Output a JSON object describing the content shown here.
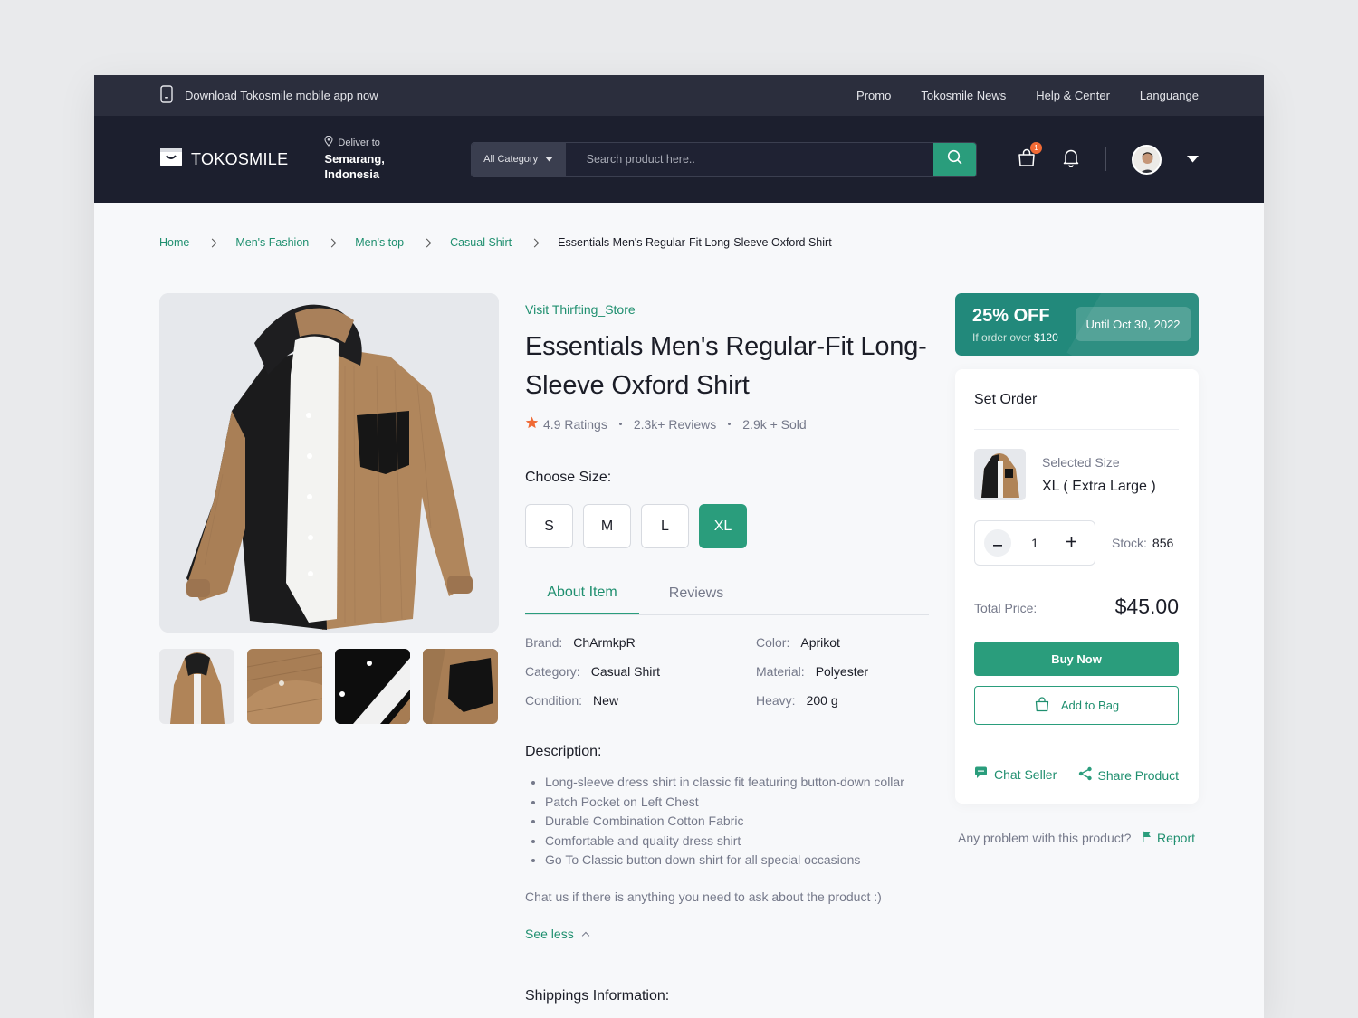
{
  "topbar": {
    "download_text": "Download Tokosmile mobile app now",
    "links": [
      "Promo",
      "Tokosmile News",
      "Help & Center",
      "Languange"
    ]
  },
  "header": {
    "logo": "TOKOSMILE",
    "deliver_label": "Deliver to",
    "deliver_location": "Semarang, Indonesia",
    "category": "All Category",
    "search_placeholder": "Search product here..",
    "bag_count": "1"
  },
  "breadcrumb": [
    "Home",
    "Men's Fashion",
    "Men's top",
    "Casual Shirt",
    "Essentials Men's Regular-Fit Long-Sleeve Oxford Shirt"
  ],
  "product": {
    "store_link": "Visit Thirfting_Store",
    "title": "Essentials Men's Regular-Fit Long-Sleeve Oxford Shirt",
    "rating": "4.9 Ratings",
    "reviews": "2.3k+ Reviews",
    "sold": "2.9k + Sold",
    "choose_size": "Choose Size:",
    "sizes": [
      "S",
      "M",
      "L",
      "XL"
    ],
    "selected_size": "XL",
    "tabs": [
      "About Item",
      "Reviews"
    ],
    "specs": {
      "brand_k": "Brand:",
      "brand_v": "ChArmkpR",
      "color_k": "Color:",
      "color_v": "Aprikot",
      "category_k": "Category:",
      "category_v": "Casual Shirt",
      "material_k": "Material:",
      "material_v": "Polyester",
      "condition_k": "Condition:",
      "condition_v": "New",
      "heavy_k": "Heavy:",
      "heavy_v": "200 g"
    },
    "description_heading": "Description:",
    "description_items": [
      "Long-sleeve dress shirt in classic fit featuring button-down collar",
      "Patch Pocket on Left Chest",
      "Durable Combination Cotton Fabric",
      "Comfortable and quality dress shirt",
      "Go To Classic button down shirt for all special occasions"
    ],
    "chat_text": "Chat us if there is anything you need to ask about the product :)",
    "see_less": "See less",
    "shipping_heading": "Shippings Information:"
  },
  "promo": {
    "discount": "25% OFF",
    "condition_prefix": "If order over",
    "condition_amount": "$120",
    "until": "Until Oct 30, 2022"
  },
  "order": {
    "heading": "Set Order",
    "selected_size_label": "Selected Size",
    "selected_size_value": "XL ( Extra Large )",
    "quantity": "1",
    "stock_label": "Stock:",
    "stock_value": "856",
    "total_label": "Total Price:",
    "total_value": "$45.00",
    "buy_now": "Buy Now",
    "add_to_bag": "Add to Bag",
    "chat_seller": "Chat Seller",
    "share_product": "Share Product"
  },
  "report": {
    "question": "Any problem with this product?",
    "link": "Report"
  },
  "colors": {
    "accent": "#2a9d7c",
    "accent_text": "#1f8f6f",
    "header_bg": "#1c1f2e",
    "topbar_bg": "#2b2e3d",
    "promo_bg": "#22897b",
    "badge": "#f06a35"
  }
}
